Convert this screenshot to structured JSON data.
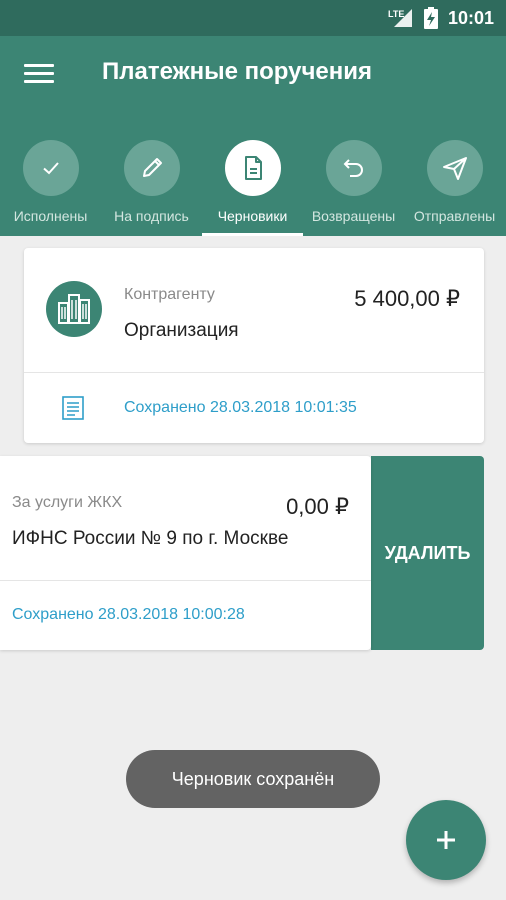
{
  "status_bar": {
    "network": "LTE",
    "time": "10:01"
  },
  "app_bar": {
    "title": "Платежные поручения"
  },
  "tabs": [
    {
      "label": "Исполнены",
      "icon": "check-icon",
      "active": false
    },
    {
      "label": "На подпись",
      "icon": "pencil-icon",
      "active": false
    },
    {
      "label": "Черновики",
      "icon": "document-icon",
      "active": true
    },
    {
      "label": "Возвращены",
      "icon": "undo-icon",
      "active": false
    },
    {
      "label": "Отправлены",
      "icon": "send-icon",
      "active": false
    }
  ],
  "drafts": [
    {
      "purpose": "Контрагенту",
      "recipient": "Организация",
      "amount": "5 400,00 ₽",
      "saved": "Сохранено 28.03.2018 10:01:35",
      "icon": "building-icon"
    },
    {
      "purpose": "За услуги ЖКХ",
      "recipient": "ИФНС России № 9 по г. Москве",
      "amount": "0,00 ₽",
      "saved": "Сохранено 28.03.2018 10:00:28",
      "swipe_action": "УДАЛИТЬ"
    }
  ],
  "toast": "Черновик сохранён",
  "fab": {
    "icon": "plus-icon"
  },
  "colors": {
    "primary": "#3c8574",
    "status_bar": "#2f6b5d",
    "link": "#2e9ec9"
  }
}
